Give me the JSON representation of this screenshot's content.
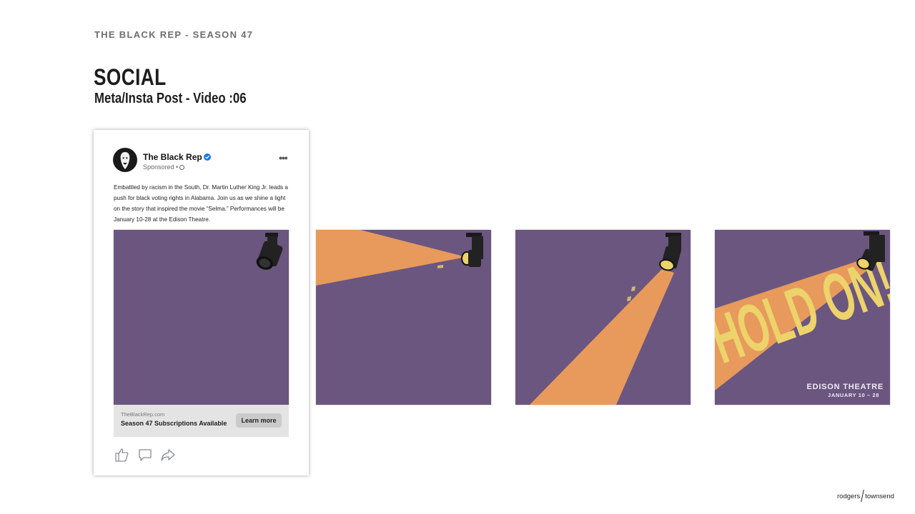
{
  "header": {
    "kicker": "THE BLACK REP - SEASON 47",
    "title": "SOCIAL",
    "subtitle": "Meta/Insta Post - Video :06"
  },
  "post": {
    "page_name": "The Black Rep",
    "sponsored": "Sponsored •",
    "caption": "Embattled by racism in the South, Dr. Martin Luther King Jr. leads a push for black voting rights in Alabama. Join us as we shine a light on the story that inspired the movie “Selma.” Performances will be January 10-28 at the Edison Theatre.",
    "cta": {
      "domain": "TheBlackRep.com",
      "headline": "Season 47 Subscriptions Available",
      "button": "Learn more"
    },
    "actions": [
      "like-icon",
      "comment-icon",
      "share-icon"
    ]
  },
  "frames": {
    "headline_text": "HOLD ON!",
    "venue": "EDISON THEATRE",
    "dates": "JANUARY 10 – 28"
  },
  "colors": {
    "background_purple": "#6b5680",
    "beam_orange": "#e79a5c",
    "headline_yellow": "#ecd36b",
    "verified_blue": "#1877f2"
  },
  "footer": {
    "brand_left": "rodgers",
    "brand_right": "townsend"
  }
}
